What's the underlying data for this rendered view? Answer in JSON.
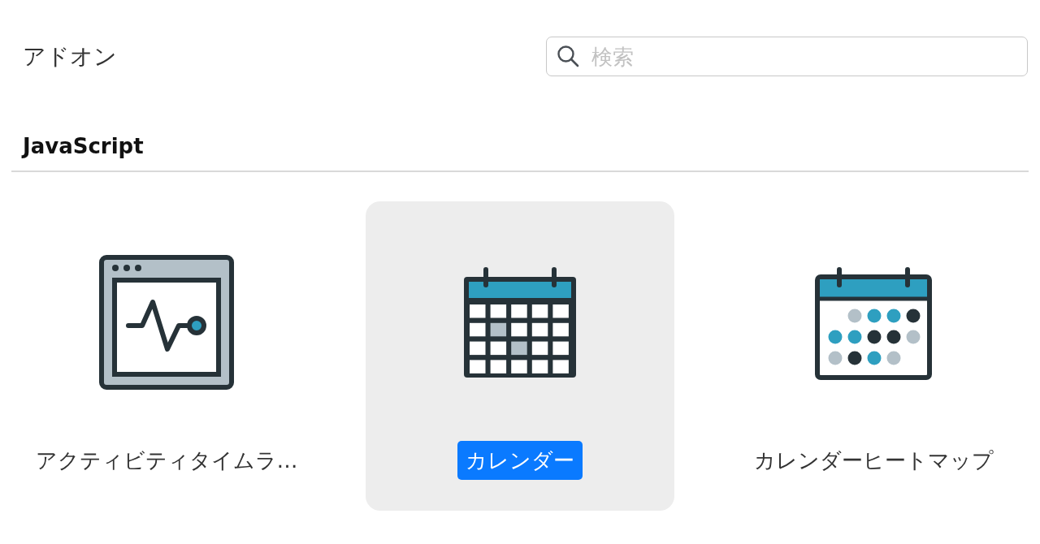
{
  "header": {
    "title": "アドオン"
  },
  "search": {
    "placeholder": "検索"
  },
  "section": {
    "heading": "JavaScript"
  },
  "addons": [
    {
      "label": "アクティビティタイムラ…",
      "kind": "activity",
      "selected": false
    },
    {
      "label": "カレンダー",
      "kind": "calendar",
      "selected": true
    },
    {
      "label": "カレンダーヒートマップ",
      "kind": "heatmap",
      "selected": false
    }
  ]
}
